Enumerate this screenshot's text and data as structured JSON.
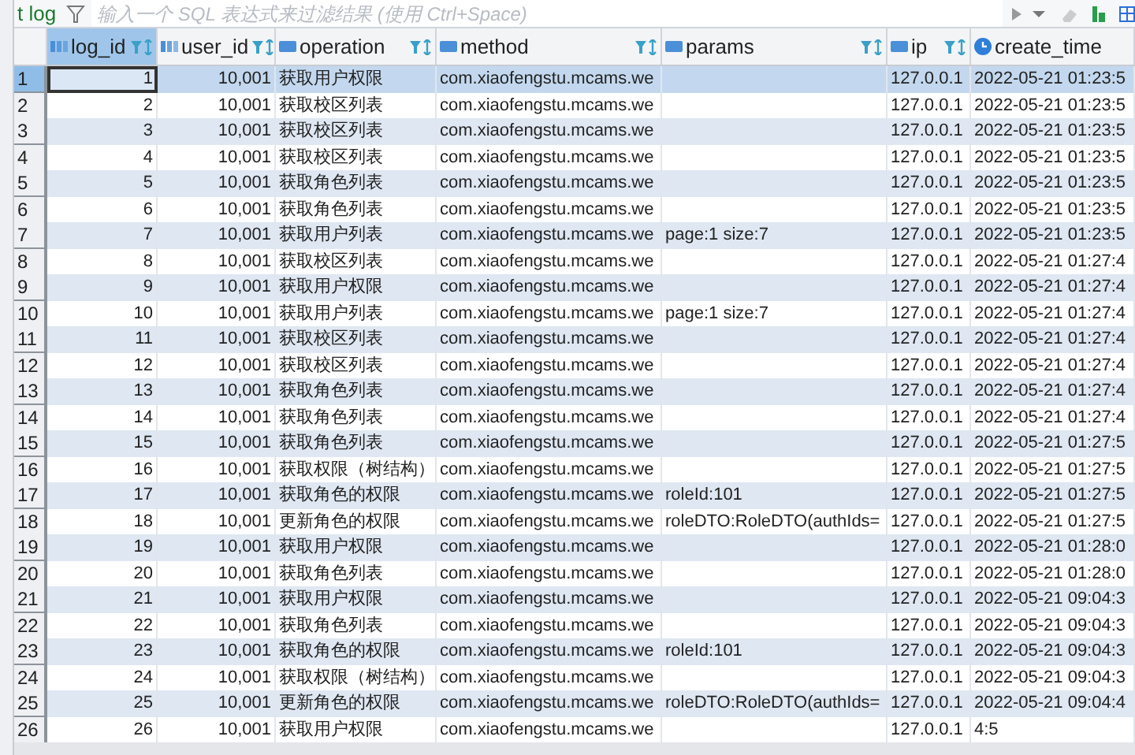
{
  "tab": {
    "label": "t log"
  },
  "filter": {
    "placeholder": "输入一个 SQL 表达式来过滤结果 (使用 Ctrl+Space)"
  },
  "table": {
    "columns": [
      {
        "label": "log_id",
        "kind": "number"
      },
      {
        "label": "user_id",
        "kind": "number"
      },
      {
        "label": "operation",
        "kind": "text"
      },
      {
        "label": "method",
        "kind": "text"
      },
      {
        "label": "params",
        "kind": "text"
      },
      {
        "label": "ip",
        "kind": "text"
      },
      {
        "label": "create_time",
        "kind": "datetime"
      }
    ],
    "rows": [
      {
        "num": "1",
        "selected": true,
        "cells": [
          "1",
          "10,001",
          "获取用户权限",
          "com.xiaofengstu.mcams.we",
          "",
          "127.0.0.1",
          "2022-05-21 01:23:5"
        ]
      },
      {
        "num": "2",
        "selected": false,
        "cells": [
          "2",
          "10,001",
          "获取校区列表",
          "com.xiaofengstu.mcams.we",
          "",
          "127.0.0.1",
          "2022-05-21 01:23:5"
        ]
      },
      {
        "num": "3",
        "selected": false,
        "cells": [
          "3",
          "10,001",
          "获取校区列表",
          "com.xiaofengstu.mcams.we",
          "",
          "127.0.0.1",
          "2022-05-21 01:23:5"
        ]
      },
      {
        "num": "4",
        "selected": false,
        "cells": [
          "4",
          "10,001",
          "获取校区列表",
          "com.xiaofengstu.mcams.we",
          "",
          "127.0.0.1",
          "2022-05-21 01:23:5"
        ]
      },
      {
        "num": "5",
        "selected": false,
        "cells": [
          "5",
          "10,001",
          "获取角色列表",
          "com.xiaofengstu.mcams.we",
          "",
          "127.0.0.1",
          "2022-05-21 01:23:5"
        ]
      },
      {
        "num": "6",
        "selected": false,
        "cells": [
          "6",
          "10,001",
          "获取角色列表",
          "com.xiaofengstu.mcams.we",
          "",
          "127.0.0.1",
          "2022-05-21 01:23:5"
        ]
      },
      {
        "num": "7",
        "selected": false,
        "cells": [
          "7",
          "10,001",
          "获取用户列表",
          "com.xiaofengstu.mcams.we",
          "page:1 size:7",
          "127.0.0.1",
          "2022-05-21 01:23:5"
        ]
      },
      {
        "num": "8",
        "selected": false,
        "cells": [
          "8",
          "10,001",
          "获取校区列表",
          "com.xiaofengstu.mcams.we",
          "",
          "127.0.0.1",
          "2022-05-21 01:27:4"
        ]
      },
      {
        "num": "9",
        "selected": false,
        "cells": [
          "9",
          "10,001",
          "获取用户权限",
          "com.xiaofengstu.mcams.we",
          "",
          "127.0.0.1",
          "2022-05-21 01:27:4"
        ]
      },
      {
        "num": "10",
        "selected": false,
        "cells": [
          "10",
          "10,001",
          "获取用户列表",
          "com.xiaofengstu.mcams.we",
          "page:1 size:7",
          "127.0.0.1",
          "2022-05-21 01:27:4"
        ]
      },
      {
        "num": "11",
        "selected": false,
        "cells": [
          "11",
          "10,001",
          "获取校区列表",
          "com.xiaofengstu.mcams.we",
          "",
          "127.0.0.1",
          "2022-05-21 01:27:4"
        ]
      },
      {
        "num": "12",
        "selected": false,
        "cells": [
          "12",
          "10,001",
          "获取校区列表",
          "com.xiaofengstu.mcams.we",
          "",
          "127.0.0.1",
          "2022-05-21 01:27:4"
        ]
      },
      {
        "num": "13",
        "selected": false,
        "cells": [
          "13",
          "10,001",
          "获取角色列表",
          "com.xiaofengstu.mcams.we",
          "",
          "127.0.0.1",
          "2022-05-21 01:27:4"
        ]
      },
      {
        "num": "14",
        "selected": false,
        "cells": [
          "14",
          "10,001",
          "获取角色列表",
          "com.xiaofengstu.mcams.we",
          "",
          "127.0.0.1",
          "2022-05-21 01:27:4"
        ]
      },
      {
        "num": "15",
        "selected": false,
        "cells": [
          "15",
          "10,001",
          "获取角色列表",
          "com.xiaofengstu.mcams.we",
          "",
          "127.0.0.1",
          "2022-05-21 01:27:5"
        ]
      },
      {
        "num": "16",
        "selected": false,
        "cells": [
          "16",
          "10,001",
          "获取权限（树结构）",
          "com.xiaofengstu.mcams.we",
          "",
          "127.0.0.1",
          "2022-05-21 01:27:5"
        ]
      },
      {
        "num": "17",
        "selected": false,
        "cells": [
          "17",
          "10,001",
          "获取角色的权限",
          "com.xiaofengstu.mcams.we",
          "roleId:101",
          "127.0.0.1",
          "2022-05-21 01:27:5"
        ]
      },
      {
        "num": "18",
        "selected": false,
        "cells": [
          "18",
          "10,001",
          "更新角色的权限",
          "com.xiaofengstu.mcams.we",
          "roleDTO:RoleDTO(authIds=",
          "127.0.0.1",
          "2022-05-21 01:27:5"
        ]
      },
      {
        "num": "19",
        "selected": false,
        "cells": [
          "19",
          "10,001",
          "获取用户权限",
          "com.xiaofengstu.mcams.we",
          "",
          "127.0.0.1",
          "2022-05-21 01:28:0"
        ]
      },
      {
        "num": "20",
        "selected": false,
        "cells": [
          "20",
          "10,001",
          "获取角色列表",
          "com.xiaofengstu.mcams.we",
          "",
          "127.0.0.1",
          "2022-05-21 01:28:0"
        ]
      },
      {
        "num": "21",
        "selected": false,
        "cells": [
          "21",
          "10,001",
          "获取用户权限",
          "com.xiaofengstu.mcams.we",
          "",
          "127.0.0.1",
          "2022-05-21 09:04:3"
        ]
      },
      {
        "num": "22",
        "selected": false,
        "cells": [
          "22",
          "10,001",
          "获取角色列表",
          "com.xiaofengstu.mcams.we",
          "",
          "127.0.0.1",
          "2022-05-21 09:04:3"
        ]
      },
      {
        "num": "23",
        "selected": false,
        "cells": [
          "23",
          "10,001",
          "获取角色的权限",
          "com.xiaofengstu.mcams.we",
          "roleId:101",
          "127.0.0.1",
          "2022-05-21 09:04:3"
        ]
      },
      {
        "num": "24",
        "selected": false,
        "cells": [
          "24",
          "10,001",
          "获取权限（树结构）",
          "com.xiaofengstu.mcams.we",
          "",
          "127.0.0.1",
          "2022-05-21 09:04:3"
        ]
      },
      {
        "num": "25",
        "selected": false,
        "cells": [
          "25",
          "10,001",
          "更新角色的权限",
          "com.xiaofengstu.mcams.we",
          "roleDTO:RoleDTO(authIds=",
          "127.0.0.1",
          "2022-05-21 09:04:4"
        ]
      },
      {
        "num": "26",
        "selected": false,
        "cells": [
          "26",
          "10,001",
          "获取用户权限",
          "com.xiaofengstu.mcams.we",
          "",
          "127.0.0.1",
          "4:5"
        ]
      }
    ]
  }
}
